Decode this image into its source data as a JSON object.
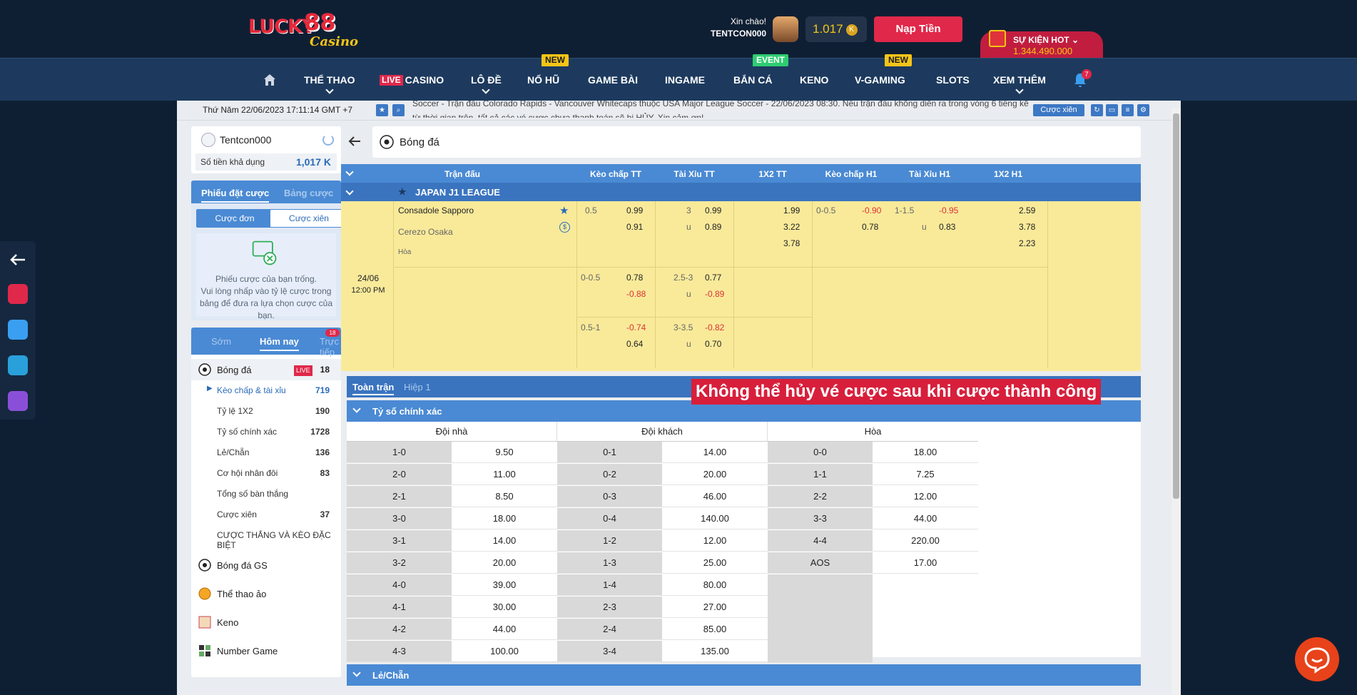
{
  "brand": {
    "logo_top": "LUCKY",
    "logo_num": "88",
    "logo_sub": "Casino"
  },
  "header": {
    "greeting": "Xin chào!",
    "username": "TENTCON000",
    "balance": "1.017",
    "balance_unit": "K",
    "deposit_label": "Nạp Tiền",
    "promo_title": "SỰ KIỆN HOT",
    "promo_amount": "1.344.490.000"
  },
  "nav": {
    "items": [
      {
        "label": "THỂ THAO"
      },
      {
        "live_tag": "LIVE",
        "label": "CASINO"
      },
      {
        "label": "LÔ ĐỀ"
      },
      {
        "label": "NỔ HŨ",
        "badge": "NEW"
      },
      {
        "label": "GAME BÀI"
      },
      {
        "label": "INGAME"
      },
      {
        "label": "BẮN CÁ",
        "badge": "EVENT"
      },
      {
        "label": "KENO"
      },
      {
        "label": "V-GAMING",
        "badge": "NEW"
      },
      {
        "label": "SLOTS"
      },
      {
        "label": "XEM THÊM"
      }
    ],
    "notif_count": "7"
  },
  "clock": "Thứ Năm 22/06/2023 17:11:14 GMT +7",
  "marquee": "Soccer - Trận đấu Colorado Rapids - Vancouver Whitecaps thuộc USA Major League Soccer - 22/06/2023 08:30. Nếu trận đấu không diễn ra trong vòng 6 tiếng kể từ thời gian trên, tất cả các vé cược chưa thanh toán sẽ bị HỦY. Xin cảm ơn!",
  "parlay_btn": "Cược xiên",
  "account": {
    "name": "Tentcon000",
    "avail_label": "Số tiền khả dụng",
    "avail_value": "1,017 K"
  },
  "slip": {
    "tab_active": "Phiếu đặt cược",
    "tab_inactive": "Bảng cược",
    "single": "Cược đơn",
    "parlay": "Cược xiên",
    "empty_1": "Phiếu cược của bạn trống.",
    "empty_2": "Vui lòng nhấp vào tỷ lệ cược trong bảng để đưa ra lựa chọn cược của bạn."
  },
  "sports_tabs": {
    "early": "Sớm",
    "today": "Hôm nay",
    "live": "Trực tiếp",
    "live_count": "18"
  },
  "sports": {
    "football": {
      "label": "Bóng đá",
      "live": "LIVE",
      "count": "18"
    },
    "subs": [
      {
        "label": "Kèo chấp & tài xỉu",
        "count": "719"
      },
      {
        "label": "Tỷ lệ 1X2",
        "count": "190"
      },
      {
        "label": "Tỷ số chính xác",
        "count": "1728"
      },
      {
        "label": "Lẻ/Chẵn",
        "count": "136"
      },
      {
        "label": "Cơ hội nhân đôi",
        "count": "83"
      },
      {
        "label": "Tổng số bàn thắng",
        "count": ""
      },
      {
        "label": "Cược xiên",
        "count": "37"
      },
      {
        "label": "CƯỢC THẮNG VÀ KÈO ĐẶC BIỆT",
        "count": ""
      }
    ],
    "others": [
      {
        "label": "Bóng đá GS"
      },
      {
        "label": "Thể thao ảo"
      },
      {
        "label": "Keno"
      },
      {
        "label": "Number Game"
      }
    ]
  },
  "content": {
    "title": "Bóng đá",
    "columns": [
      "Trận đấu",
      "Kèo chấp TT",
      "Tài Xỉu TT",
      "1X2 TT",
      "Kèo chấp H1",
      "Tài Xỉu H1",
      "1X2 H1"
    ],
    "league": "JAPAN J1 LEAGUE",
    "match": {
      "home": "Consadole Sapporo",
      "away": "Cerezo Osaka",
      "draw": "Hòa",
      "date": "24/06",
      "time": "12:00 PM",
      "rows": [
        {
          "hdp": "0.5",
          "hdp_o1": "0.99",
          "hdp_o2": "0.91",
          "ou": "3",
          "ou_u": "u",
          "ou_o1": "0.99",
          "ou_o2": "0.89",
          "x1": "1.99",
          "x2": "3.22",
          "x3": "3.78",
          "h1_hdp": "0-0.5",
          "h1_o1": "-0.90",
          "h1_o2": "0.78",
          "h1_ou": "1-1.5",
          "h1_u": "u",
          "h1_ou1": "-0.95",
          "h1_ou2": "0.83",
          "h1x1": "2.59",
          "h1x2": "3.78",
          "h1x3": "2.23"
        },
        {
          "hdp": "0-0.5",
          "hdp_o1": "0.78",
          "hdp_o2": "-0.88",
          "ou": "2.5-3",
          "ou_u": "u",
          "ou_o1": "0.77",
          "ou_o2": "-0.89"
        },
        {
          "hdp": "0.5-1",
          "hdp_o1": "-0.74",
          "hdp_o2": "0.64",
          "ou": "3-3.5",
          "ou_u": "u",
          "ou_o1": "-0.82",
          "ou_o2": "0.70"
        }
      ]
    },
    "market_tabs": {
      "full": "Toàn trận",
      "half": "Hiệp 1"
    },
    "overlay": "Không thể hủy vé cược sau khi cược thành công",
    "cs": {
      "title": "Tỷ số chính xác",
      "home_label": "Đội nhà",
      "away_label": "Đội khách",
      "draw_label": "Hòa",
      "home": [
        [
          "1-0",
          "9.50"
        ],
        [
          "2-0",
          "11.00"
        ],
        [
          "2-1",
          "8.50"
        ],
        [
          "3-0",
          "18.00"
        ],
        [
          "3-1",
          "14.00"
        ],
        [
          "3-2",
          "20.00"
        ],
        [
          "4-0",
          "39.00"
        ],
        [
          "4-1",
          "30.00"
        ],
        [
          "4-2",
          "44.00"
        ],
        [
          "4-3",
          "100.00"
        ]
      ],
      "away": [
        [
          "0-1",
          "14.00"
        ],
        [
          "0-2",
          "20.00"
        ],
        [
          "0-3",
          "46.00"
        ],
        [
          "0-4",
          "140.00"
        ],
        [
          "1-2",
          "12.00"
        ],
        [
          "1-3",
          "25.00"
        ],
        [
          "1-4",
          "80.00"
        ],
        [
          "2-3",
          "27.00"
        ],
        [
          "2-4",
          "85.00"
        ],
        [
          "3-4",
          "135.00"
        ]
      ],
      "draw": [
        [
          "0-0",
          "18.00"
        ],
        [
          "1-1",
          "7.25"
        ],
        [
          "2-2",
          "12.00"
        ],
        [
          "3-3",
          "44.00"
        ],
        [
          "4-4",
          "220.00"
        ],
        [
          "AOS",
          "17.00"
        ]
      ]
    },
    "oddeven_title": "Lẻ/Chẵn"
  },
  "colors": {
    "accent": "#4a8ad4",
    "deposit": "#e0284a",
    "odds_bg": "#f9ea9a",
    "negative": "#dd3333"
  }
}
